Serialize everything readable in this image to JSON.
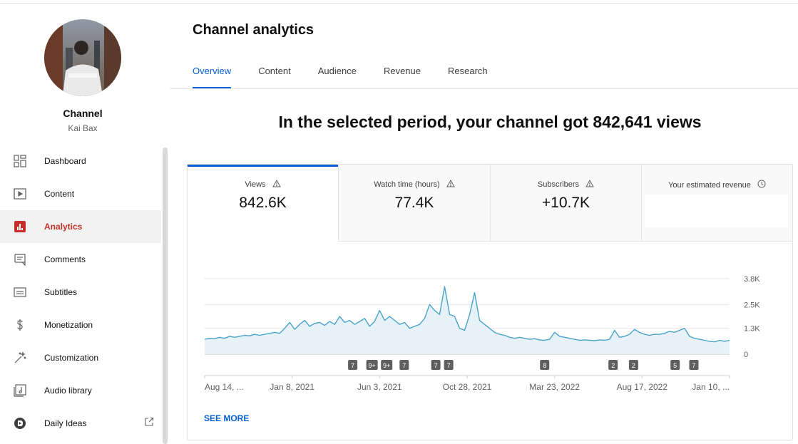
{
  "sidebar": {
    "channel_label": "Channel",
    "channel_name": "Kai Bax",
    "avatar_text": "SPENCER",
    "items": [
      {
        "label": "Dashboard",
        "icon": "dashboard-icon"
      },
      {
        "label": "Content",
        "icon": "content-icon"
      },
      {
        "label": "Analytics",
        "icon": "analytics-icon",
        "active": true
      },
      {
        "label": "Comments",
        "icon": "comments-icon"
      },
      {
        "label": "Subtitles",
        "icon": "subtitles-icon"
      },
      {
        "label": "Monetization",
        "icon": "monetization-icon"
      },
      {
        "label": "Customization",
        "icon": "customization-icon"
      },
      {
        "label": "Audio library",
        "icon": "audio-library-icon"
      },
      {
        "label": "Daily Ideas",
        "icon": "daily-ideas-icon",
        "external": true
      }
    ]
  },
  "header": {
    "title": "Channel analytics",
    "tabs": [
      "Overview",
      "Content",
      "Audience",
      "Revenue",
      "Research"
    ],
    "active_tab": "Overview"
  },
  "headline": "In the selected period, your channel got 842,641 views",
  "metrics": [
    {
      "label": "Views",
      "value": "842.6K",
      "icon": "warning-icon"
    },
    {
      "label": "Watch time (hours)",
      "value": "77.4K",
      "icon": "warning-icon"
    },
    {
      "label": "Subscribers",
      "value": "+10.7K",
      "icon": "warning-icon"
    },
    {
      "label": "Your estimated revenue",
      "value": "",
      "icon": "clock-icon"
    }
  ],
  "see_more": "SEE MORE",
  "colors": {
    "accent": "#065fd4",
    "line": "#4aa3c8",
    "fill": "#e7f2f8",
    "active_nav": "#c4302b"
  },
  "chart_data": {
    "type": "area",
    "title": "",
    "xlabel": "",
    "ylabel": "",
    "x_start": "2020-08-14",
    "x_end": "2023-01-28",
    "x_tick_labels": [
      "Aug 14, ...",
      "Jan 8, 2021",
      "Jun 3, 2021",
      "Oct 28, 2021",
      "Mar 23, 2022",
      "Aug 17, 2022",
      "Jan 10, ..."
    ],
    "y_tick_labels": [
      "0",
      "1.3K",
      "2.5K",
      "3.8K"
    ],
    "y_ticks": [
      0,
      1300,
      2500,
      3800
    ],
    "ylim": [
      0,
      3800
    ],
    "grid": true,
    "series": [
      {
        "values": [
          750,
          800,
          780,
          850,
          800,
          900,
          850,
          900,
          950,
          920,
          1000,
          950,
          1000,
          1050,
          1100,
          1050,
          1300,
          1600,
          1250,
          1500,
          1700,
          1400,
          1550,
          1600,
          1450,
          1650,
          1500,
          1900,
          1600,
          1700,
          1500,
          1650,
          1800,
          1400,
          1650,
          2200,
          1700,
          1900,
          1700,
          1500,
          1600,
          1300,
          1400,
          1500,
          1800,
          2500,
          2200,
          2000,
          3400,
          2000,
          1900,
          1300,
          1200,
          2000,
          3100,
          1700,
          1500,
          1300,
          1100,
          1000,
          950,
          850,
          800,
          850,
          800,
          750,
          780,
          720,
          700,
          750,
          1100,
          900,
          850,
          800,
          750,
          700,
          720,
          700,
          680,
          720,
          700,
          750,
          1200,
          850,
          900,
          1000,
          1250,
          1100,
          1000,
          950,
          1000,
          1000,
          1050,
          1150,
          1100,
          1200,
          1300,
          900,
          800,
          750,
          700,
          650,
          620,
          700,
          650,
          700
        ]
      }
    ],
    "annotations": [
      {
        "date": "2021-04-24",
        "label": "7"
      },
      {
        "date": "2021-05-27",
        "label": "9+"
      },
      {
        "date": "2021-06-21",
        "label": "9+"
      },
      {
        "date": "2021-07-21",
        "label": "7"
      },
      {
        "date": "2021-09-13",
        "label": "7"
      },
      {
        "date": "2021-10-05",
        "label": "7"
      },
      {
        "date": "2022-03-18",
        "label": "8"
      },
      {
        "date": "2022-07-13",
        "label": "2"
      },
      {
        "date": "2022-08-17",
        "label": "2"
      },
      {
        "date": "2022-10-27",
        "label": "5"
      },
      {
        "date": "2022-11-28",
        "label": "7"
      }
    ]
  }
}
